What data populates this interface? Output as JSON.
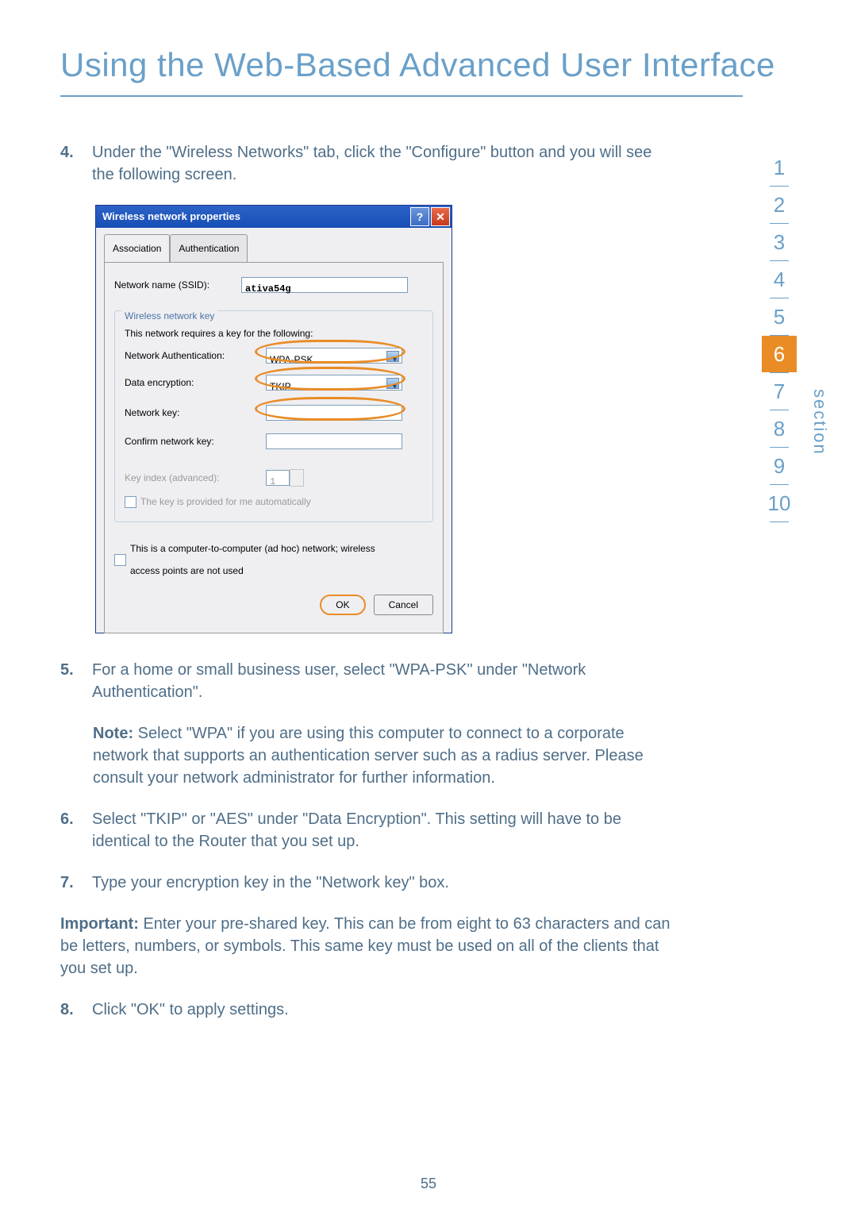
{
  "heading": "Using the Web-Based Advanced User Interface",
  "steps": {
    "n4": "4.",
    "t4": "Under the \"Wireless Networks\" tab, click the \"Configure\" button and you will see the following screen.",
    "n5": "5.",
    "t5": "For a home or small business user, select \"WPA-PSK\" under \"Network Authentication\".",
    "noteLabel": "Note:",
    "t5n": " Select \"WPA\" if you are using this computer to connect to a corporate network that supports an authentication server such as a radius server. Please consult your network administrator for further information.",
    "n6": "6.",
    "t6": "Select \"TKIP\" or \"AES\" under \"Data Encryption\". This setting will have to be identical to the Router that you set up.",
    "n7": "7.",
    "t7": "Type your encryption key in the \"Network key\" box.",
    "impLabel": "Important:",
    "imp": " Enter your pre-shared key. This can be from eight to 63 characters and can be letters, numbers, or symbols. This same key must be used on all of the clients that you set up.",
    "n8": "8.",
    "t8": "Click \"OK\" to apply settings."
  },
  "dialog": {
    "title": "Wireless network properties",
    "help": "?",
    "close": "✕",
    "tab1": "Association",
    "tab2": "Authentication",
    "ssidLabel": "Network name (SSID):",
    "ssid": "ativa54g",
    "group": "Wireless network key",
    "groupDesc": "This network requires a key for the following:",
    "authLabel": "Network Authentication:",
    "auth": "WPA-PSK",
    "encLabel": "Data encryption:",
    "enc": "TKIP",
    "keyLabel": "Network key:",
    "confLabel": "Confirm network key:",
    "idxLabel": "Key index (advanced):",
    "idx": "1",
    "auto": "The key is provided for me automatically",
    "adhoc": "This is a computer-to-computer (ad hoc) network; wireless access points are not used",
    "ok": "OK",
    "cancel": "Cancel"
  },
  "nav": {
    "n1": "1",
    "n2": "2",
    "n3": "3",
    "n4": "4",
    "n5": "5",
    "n6": "6",
    "n7": "7",
    "n8": "8",
    "n9": "9",
    "n10": "10",
    "label": "section"
  },
  "pageNumber": "55"
}
